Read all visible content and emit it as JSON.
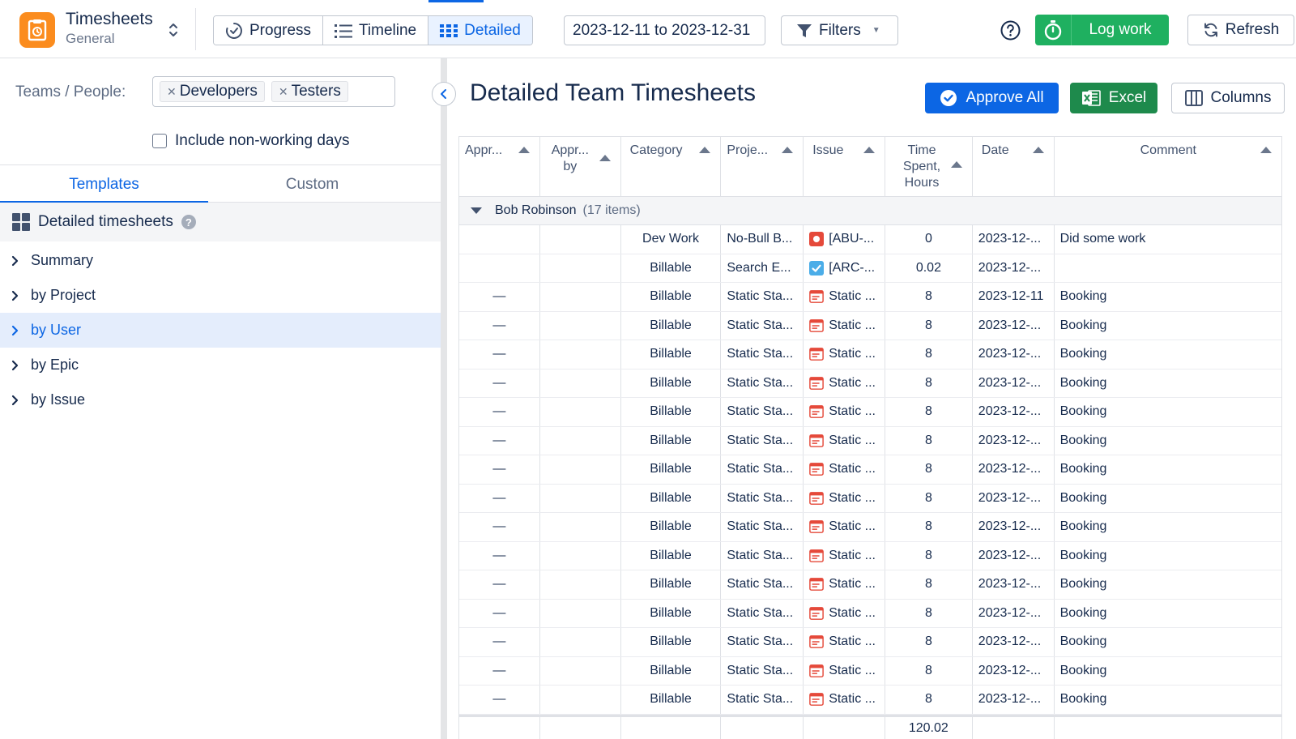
{
  "app": {
    "title": "Timesheets",
    "subtitle": "General"
  },
  "views": [
    {
      "label": "Progress",
      "icon": "progress-icon"
    },
    {
      "label": "Timeline",
      "icon": "list-icon"
    },
    {
      "label": "Detailed",
      "icon": "grid-icon",
      "active": true
    }
  ],
  "date_range": "2023-12-11 to 2023-12-31",
  "filters_label": "Filters",
  "log_work_label": "Log work",
  "refresh_label": "Refresh",
  "left": {
    "teams_label": "Teams / People:",
    "chips": [
      "Developers",
      "Testers"
    ],
    "nonworking_label": "Include non-working days",
    "tabs": [
      "Templates",
      "Custom"
    ],
    "templates_header": "Detailed timesheets",
    "tree": [
      "Summary",
      "by Project",
      "by User",
      "by Epic",
      "by Issue"
    ],
    "selected_tree_index": 2
  },
  "main": {
    "title": "Detailed Team Timesheets",
    "approve_all_label": "Approve All",
    "excel_label": "Excel",
    "columns_label": "Columns"
  },
  "colors": {
    "accent": "#0c66e4",
    "green": "#1fb060",
    "excel": "#1e8a4c",
    "logo": "#fb8c1e"
  },
  "table": {
    "headers": [
      "Appr...",
      "Appr... by",
      "Category",
      "Proje...",
      "Issue",
      "Time Spent, Hours",
      "Date",
      "Comment"
    ],
    "group": {
      "name": "Bob Robinson",
      "count": "(17 items)"
    },
    "rows": [
      {
        "approval": "",
        "approved_by": "",
        "category": "Dev Work",
        "project": "No-Bull B...",
        "issue_type": "bug",
        "issue": "[ABU-...",
        "hours": "0",
        "date": "2023-12-...",
        "comment": "Did some work"
      },
      {
        "approval": "",
        "approved_by": "",
        "category": "Billable",
        "project": "Search E...",
        "issue_type": "task",
        "issue": "[ARC-...",
        "hours": "0.02",
        "date": "2023-12-...",
        "comment": ""
      },
      {
        "approval": "—",
        "approved_by": "",
        "category": "Billable",
        "project": "Static Sta...",
        "issue_type": "story",
        "issue": "Static ...",
        "hours": "8",
        "date": "2023-12-11",
        "comment": "Booking"
      },
      {
        "approval": "—",
        "approved_by": "",
        "category": "Billable",
        "project": "Static Sta...",
        "issue_type": "story",
        "issue": "Static ...",
        "hours": "8",
        "date": "2023-12-...",
        "comment": "Booking"
      },
      {
        "approval": "—",
        "approved_by": "",
        "category": "Billable",
        "project": "Static Sta...",
        "issue_type": "story",
        "issue": "Static ...",
        "hours": "8",
        "date": "2023-12-...",
        "comment": "Booking"
      },
      {
        "approval": "—",
        "approved_by": "",
        "category": "Billable",
        "project": "Static Sta...",
        "issue_type": "story",
        "issue": "Static ...",
        "hours": "8",
        "date": "2023-12-...",
        "comment": "Booking"
      },
      {
        "approval": "—",
        "approved_by": "",
        "category": "Billable",
        "project": "Static Sta...",
        "issue_type": "story",
        "issue": "Static ...",
        "hours": "8",
        "date": "2023-12-...",
        "comment": "Booking"
      },
      {
        "approval": "—",
        "approved_by": "",
        "category": "Billable",
        "project": "Static Sta...",
        "issue_type": "story",
        "issue": "Static ...",
        "hours": "8",
        "date": "2023-12-...",
        "comment": "Booking"
      },
      {
        "approval": "—",
        "approved_by": "",
        "category": "Billable",
        "project": "Static Sta...",
        "issue_type": "story",
        "issue": "Static ...",
        "hours": "8",
        "date": "2023-12-...",
        "comment": "Booking"
      },
      {
        "approval": "—",
        "approved_by": "",
        "category": "Billable",
        "project": "Static Sta...",
        "issue_type": "story",
        "issue": "Static ...",
        "hours": "8",
        "date": "2023-12-...",
        "comment": "Booking"
      },
      {
        "approval": "—",
        "approved_by": "",
        "category": "Billable",
        "project": "Static Sta...",
        "issue_type": "story",
        "issue": "Static ...",
        "hours": "8",
        "date": "2023-12-...",
        "comment": "Booking"
      },
      {
        "approval": "—",
        "approved_by": "",
        "category": "Billable",
        "project": "Static Sta...",
        "issue_type": "story",
        "issue": "Static ...",
        "hours": "8",
        "date": "2023-12-...",
        "comment": "Booking"
      },
      {
        "approval": "—",
        "approved_by": "",
        "category": "Billable",
        "project": "Static Sta...",
        "issue_type": "story",
        "issue": "Static ...",
        "hours": "8",
        "date": "2023-12-...",
        "comment": "Booking"
      },
      {
        "approval": "—",
        "approved_by": "",
        "category": "Billable",
        "project": "Static Sta...",
        "issue_type": "story",
        "issue": "Static ...",
        "hours": "8",
        "date": "2023-12-...",
        "comment": "Booking"
      },
      {
        "approval": "—",
        "approved_by": "",
        "category": "Billable",
        "project": "Static Sta...",
        "issue_type": "story",
        "issue": "Static ...",
        "hours": "8",
        "date": "2023-12-...",
        "comment": "Booking"
      },
      {
        "approval": "—",
        "approved_by": "",
        "category": "Billable",
        "project": "Static Sta...",
        "issue_type": "story",
        "issue": "Static ...",
        "hours": "8",
        "date": "2023-12-...",
        "comment": "Booking"
      },
      {
        "approval": "—",
        "approved_by": "",
        "category": "Billable",
        "project": "Static Sta...",
        "issue_type": "story",
        "issue": "Static ...",
        "hours": "8",
        "date": "2023-12-...",
        "comment": "Booking"
      }
    ],
    "total_hours": "120.02"
  }
}
